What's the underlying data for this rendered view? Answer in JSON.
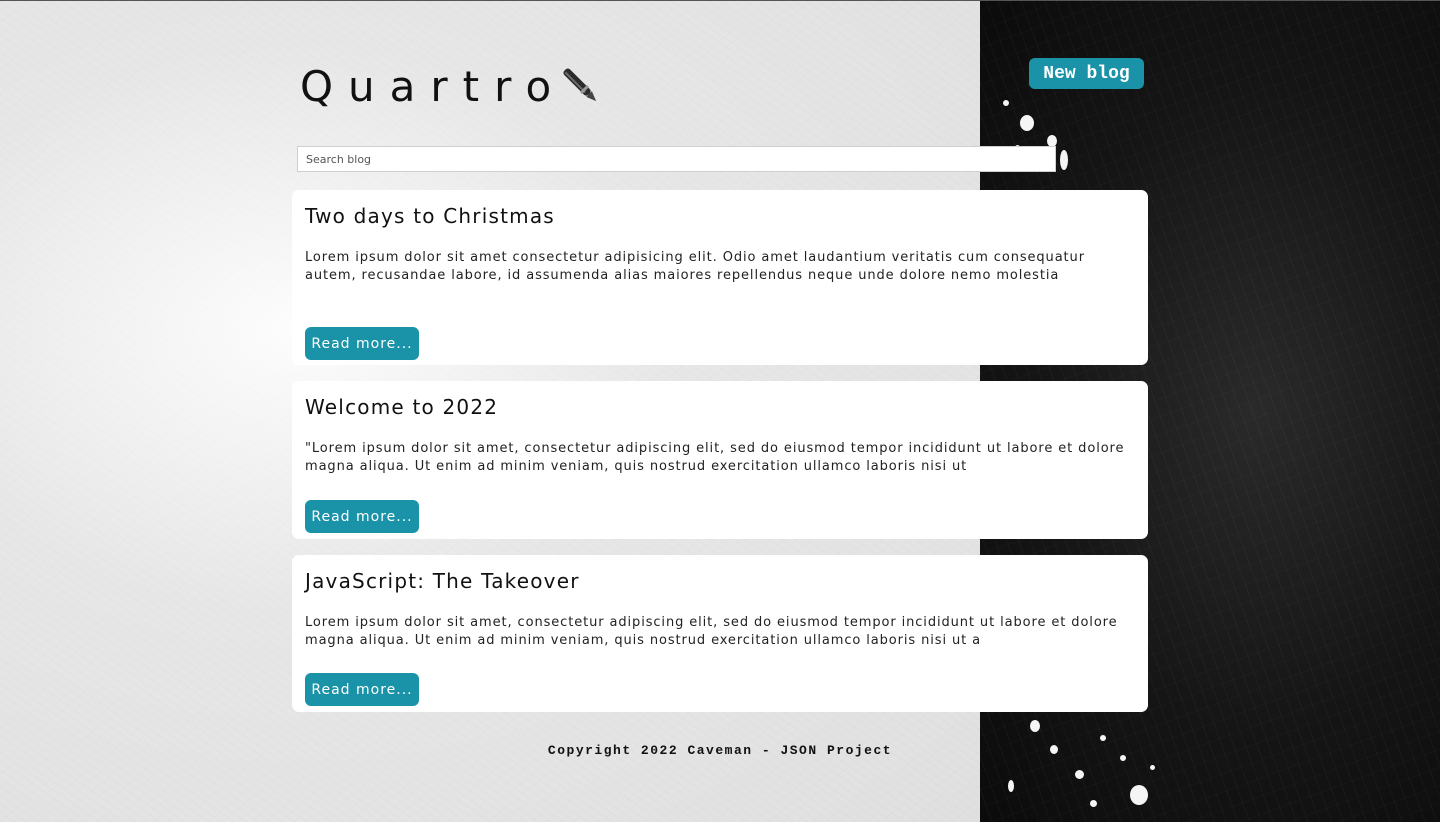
{
  "header": {
    "logo_text": "Quartro",
    "new_blog_label": "New blog"
  },
  "search": {
    "placeholder": "Search blog",
    "value": ""
  },
  "posts": [
    {
      "title": "Two days to Christmas",
      "excerpt": "Lorem ipsum dolor sit amet consectetur adipisicing elit. Odio amet laudantium veritatis cum consequatur autem, recusandae labore, id assumenda alias maiores repellendus neque unde dolore nemo molestia",
      "button_label": "Read more..."
    },
    {
      "title": "Welcome to 2022",
      "excerpt": "\"Lorem ipsum dolor sit amet, consectetur adipiscing elit, sed do eiusmod tempor incididunt ut labore et dolore magna aliqua. Ut enim ad minim veniam, quis nostrud exercitation ullamco laboris nisi ut",
      "button_label": "Read more..."
    },
    {
      "title": "JavaScript: The Takeover",
      "excerpt": "Lorem ipsum dolor sit amet, consectetur adipiscing elit, sed do eiusmod tempor incididunt ut labore et dolore magna aliqua. Ut enim ad minim veniam, quis nostrud exercitation ullamco laboris nisi ut a",
      "button_label": "Read more..."
    }
  ],
  "footer": {
    "copyright": "Copyright 2022 Caveman - JSON Project"
  },
  "colors": {
    "accent": "#1a93a8",
    "card_bg": "#ffffff",
    "text": "#111111"
  },
  "icons": {
    "logo_icon": "pen-icon"
  }
}
